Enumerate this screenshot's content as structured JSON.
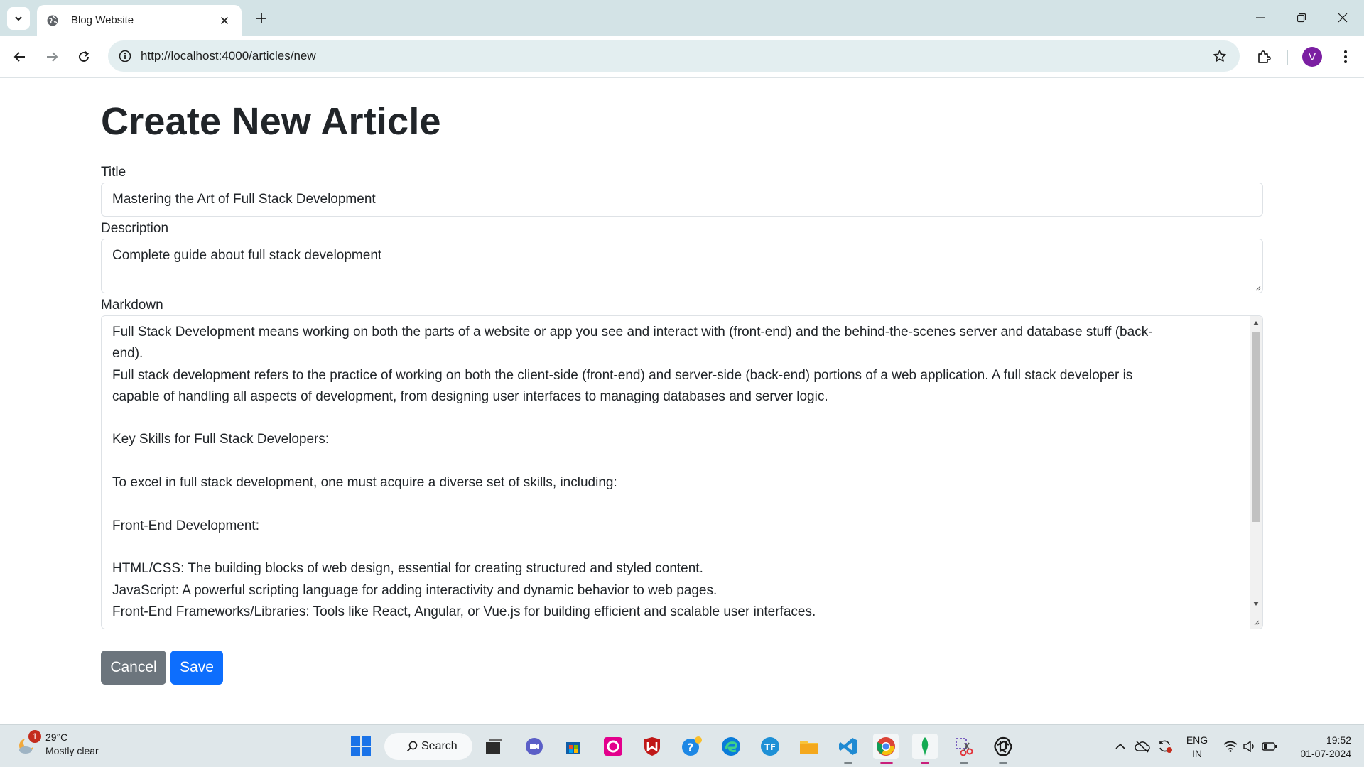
{
  "browser": {
    "tab_title": "Blog Website",
    "url": "http://localhost:4000/articles/new",
    "profile_initial": "V"
  },
  "page": {
    "heading": "Create New Article",
    "title_label": "Title",
    "title_value": "Mastering the Art of Full Stack Development",
    "description_label": "Description",
    "description_value": "Complete guide about full stack development",
    "markdown_label": "Markdown",
    "markdown_lines": [
      "Full Stack Development means working on both the parts of a website or app you see and interact with (front-end) and the behind-the-scenes server and database stuff (back-",
      "end).",
      "Full stack development refers to the practice of working on both the client-side (front-end) and server-side (back-end) portions of a web application. A full stack developer is",
      "capable of handling all aspects of development, from designing user interfaces to managing databases and server logic.",
      "",
      "Key Skills for Full Stack Developers:",
      "",
      "To excel in full stack development, one must acquire a diverse set of skills, including:",
      "",
      "Front-End Development:",
      "",
      "HTML/CSS: The building blocks of web design, essential for creating structured and styled content.",
      "JavaScript: A powerful scripting language for adding interactivity and dynamic behavior to web pages.",
      "Front-End Frameworks/Libraries: Tools like React, Angular, or Vue.js for building efficient and scalable user interfaces."
    ],
    "cancel_label": "Cancel",
    "save_label": "Save"
  },
  "taskbar": {
    "weather_temp": "29°C",
    "weather_desc": "Mostly clear",
    "weather_badge": "1",
    "search_label": "Search",
    "lang_top": "ENG",
    "lang_bottom": "IN",
    "time": "19:52",
    "date": "01-07-2024"
  },
  "colors": {
    "primary": "#0d6efd",
    "secondary": "#6c757d",
    "chrome_tabbar": "#d3e3e6",
    "omnibox": "#e3eef0"
  }
}
